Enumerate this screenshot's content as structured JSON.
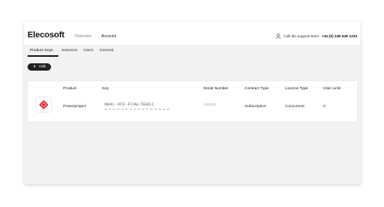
{
  "header": {
    "logo": "Elecosoft",
    "nav": [
      "Overview",
      "Account"
    ],
    "support_text": "Call the support team",
    "support_phone": "+44 (0) 345 646 1232"
  },
  "tabs": [
    "Product Keys",
    "Sessions",
    "Users",
    "General"
  ],
  "active_tab": "Product Keys",
  "add_button_label": "Add",
  "table": {
    "columns": [
      "Product",
      "Key",
      "Serial Number",
      "Contract Type",
      "Licence Type",
      "User Limit"
    ],
    "rows": [
      {
        "product": "Powerproject",
        "key": "NW4L-9PZ-FC4W-5EWSJ",
        "serial": "11234",
        "contract_type": "Subscription",
        "licence_type": "Concurrent",
        "user_limit": "0"
      }
    ]
  },
  "colors": {
    "accent": "#222222",
    "product_icon": "#d9232d"
  }
}
